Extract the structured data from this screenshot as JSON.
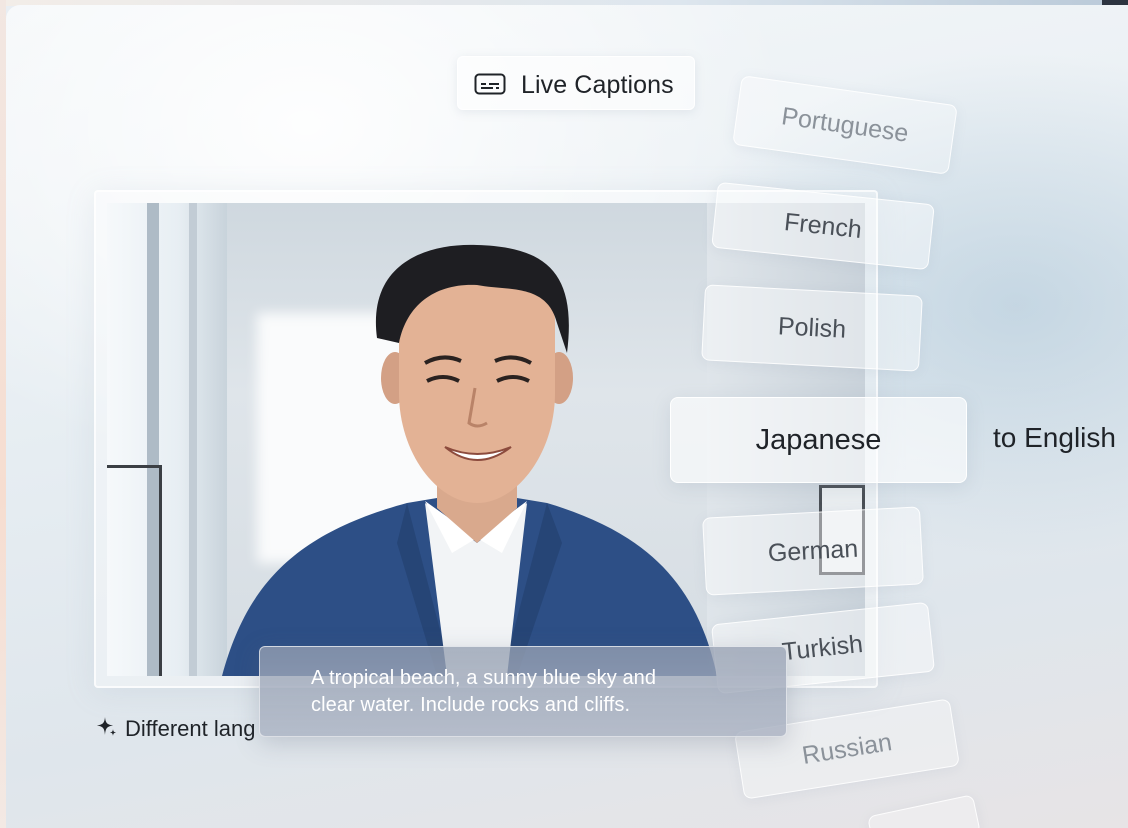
{
  "header": {
    "title": "Live Captions",
    "icon": "closed-captions-icon"
  },
  "video": {
    "caption_lines": [
      "A tropical beach, a sunny blue sky and",
      "clear water. Include rocks and cliffs."
    ]
  },
  "footer": {
    "label": "Different lang",
    "icon": "sparkle-icon"
  },
  "languages": {
    "items": [
      "Portuguese",
      "French",
      "Polish",
      "Japanese",
      "German",
      "Turkish",
      "Russian"
    ],
    "selected": "Japanese",
    "target_label": "to English"
  },
  "colors": {
    "text_primary": "#1f2328",
    "caption_bg": "#9aa2b4",
    "caption_text": "#ffffff"
  }
}
